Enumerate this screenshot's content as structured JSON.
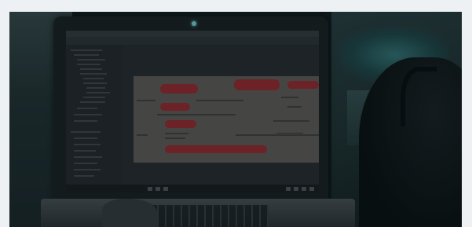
{
  "scene": {
    "subject": "laptop-with-redacted-document",
    "colors": {
      "page_bg": "#eef1f4",
      "room": "#111a1d",
      "teal_highlight": "#3d8a8c",
      "redaction": "#b8232a",
      "camera_light": "#7de0e6"
    }
  }
}
